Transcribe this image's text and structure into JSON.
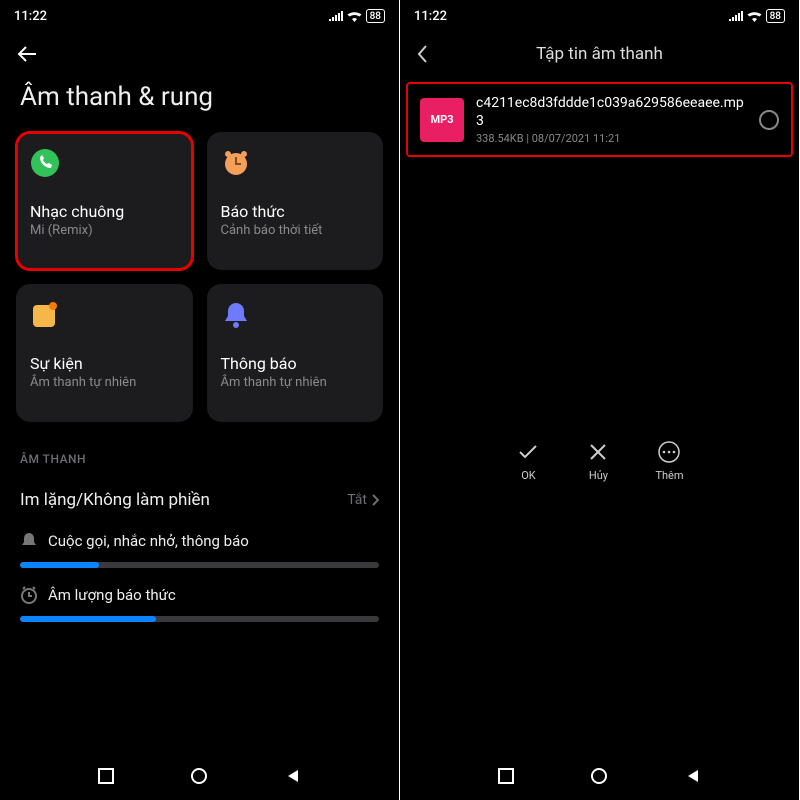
{
  "statusbar": {
    "time": "11:22",
    "battery": "88"
  },
  "left": {
    "title": "Âm thanh & rung",
    "cards": [
      {
        "label": "Nhạc chuông",
        "sub": "Mi (Remix)",
        "icon": "phone",
        "highlight": true
      },
      {
        "label": "Báo thức",
        "sub": "Cảnh báo thời tiết",
        "icon": "alarm",
        "highlight": false
      },
      {
        "label": "Sự kiện",
        "sub": "Âm thanh tự nhiên",
        "icon": "calendar",
        "highlight": false
      },
      {
        "label": "Thông báo",
        "sub": "Âm thanh tự nhiên",
        "icon": "bell",
        "highlight": false
      }
    ],
    "sectionHeader": "ÂM THANH",
    "dnd": {
      "label": "Im lặng/Không làm phiền",
      "value": "Tắt"
    },
    "slider1": {
      "label": "Cuộc gọi, nhắc nhở, thông báo",
      "pct": 22
    },
    "slider2": {
      "label": "Âm lượng báo thức",
      "pct": 38
    }
  },
  "right": {
    "title": "Tập tin âm thanh",
    "file": {
      "badge": "MP3",
      "name": "c4211ec8d3fddde1c039a629586eeaee.mp3",
      "size": "338.54KB",
      "sep": "|",
      "date": "08/07/2021 11:21"
    },
    "actions": {
      "ok": "OK",
      "cancel": "Hủy",
      "more": "Thêm"
    }
  }
}
